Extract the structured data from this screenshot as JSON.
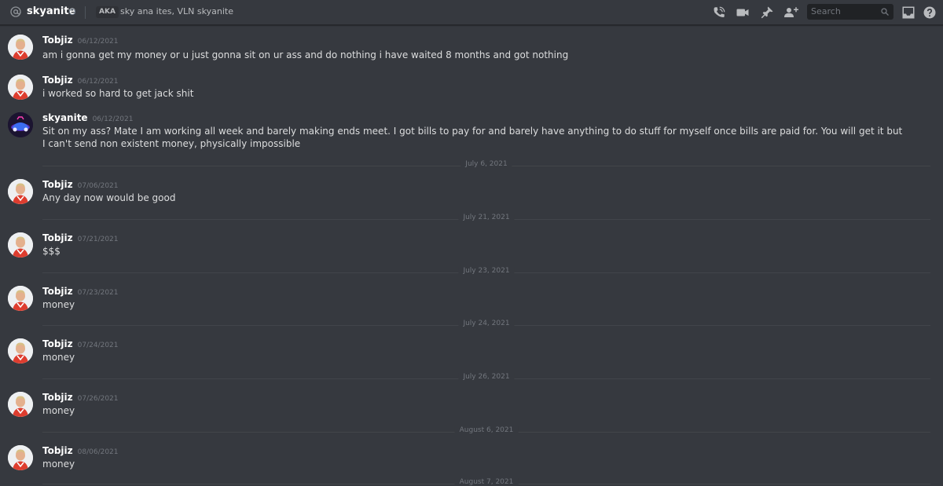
{
  "header": {
    "username": "skyanite",
    "aka_label": "AKA",
    "aka_names": "sky ana ites, VLN skyanite",
    "search_placeholder": "Search",
    "icons": [
      "call-icon",
      "video-icon",
      "pin-icon",
      "add-friend-icon",
      "search-icon",
      "inbox-icon",
      "help-icon"
    ]
  },
  "messages": [
    {
      "author": "Tobjiz",
      "timestamp": "06/12/2021",
      "text": "am i gonna get my money or u just gonna sit on ur ass and do nothing i have waited 8 months and got nothing"
    },
    {
      "author": "Tobjiz",
      "timestamp": "06/12/2021",
      "text": "i worked so hard to get jack shit"
    },
    {
      "author": "skyanite",
      "timestamp": "06/12/2021",
      "text": "Sit on my ass? Mate I am working all week and barely making ends meet. I got bills to pay for and barely have anything to do stuff for myself once bills are paid for. You will get it but I can't send non existent money, physically impossible"
    },
    {
      "author": "Tobjiz",
      "timestamp": "07/06/2021",
      "text": "Any day now would be good"
    },
    {
      "author": "Tobjiz",
      "timestamp": "07/21/2021",
      "text": "$$$"
    },
    {
      "author": "Tobjiz",
      "timestamp": "07/23/2021",
      "text": "money"
    },
    {
      "author": "Tobjiz",
      "timestamp": "07/24/2021",
      "text": "money"
    },
    {
      "author": "Tobjiz",
      "timestamp": "07/26/2021",
      "text": "money"
    },
    {
      "author": "Tobjiz",
      "timestamp": "08/06/2021",
      "text": "money"
    }
  ],
  "date_separators": [
    "July 6, 2021",
    "July 21, 2021",
    "July 23, 2021",
    "July 24, 2021",
    "July 26, 2021",
    "August 6, 2021",
    "August 7, 2021"
  ],
  "colors": {
    "background": "#36393f",
    "text": "#dcddde",
    "muted": "#72767d",
    "author": "#ffffff"
  }
}
